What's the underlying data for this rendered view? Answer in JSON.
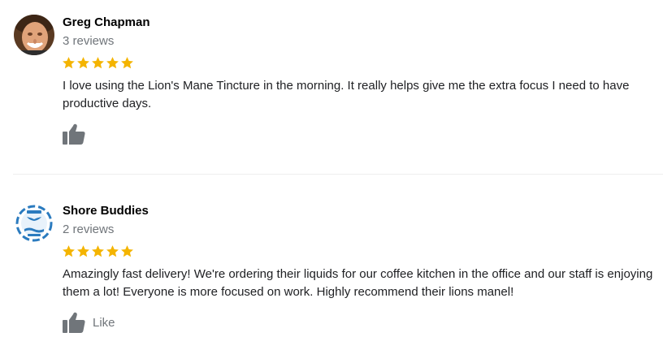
{
  "reviews": [
    {
      "reviewer_name": "Greg Chapman",
      "review_count": "3 reviews",
      "rating": 5,
      "rating_max": 5,
      "avatar_icon": "person-photo-avatar",
      "text": "I love using the Lion's Mane Tincture in the morning. It really helps give me the extra focus I need to have productive days.",
      "like_icon": "thumbs-up-icon",
      "like_label": ""
    },
    {
      "reviewer_name": "Shore Buddies",
      "review_count": "2 reviews",
      "rating": 5,
      "rating_max": 5,
      "avatar_icon": "whale-tail-logo-avatar",
      "text": "Amazingly fast delivery! We're ordering their liquids for our coffee kitchen in the office and our staff is enjoying them a lot! Everyone is more focused on work. Highly recommend their lions manel!",
      "like_icon": "thumbs-up-icon",
      "like_label": "Like"
    }
  ],
  "colors": {
    "star": "#f4b400",
    "icon": "#70757a",
    "name": "#000000",
    "secondary_text": "#70757a",
    "body_text": "#202124",
    "logo_blue": "#2b7bbf"
  }
}
